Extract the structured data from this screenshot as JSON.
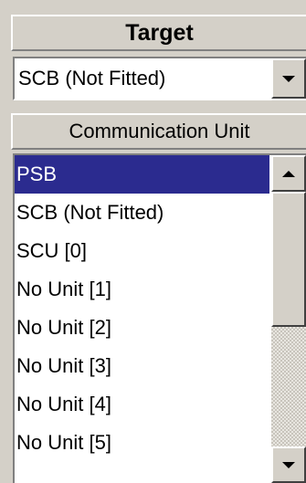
{
  "target_header": "Target",
  "target_select": {
    "value": "SCB (Not Fitted)"
  },
  "comm_header": "Communication Unit",
  "comm_list": {
    "items": [
      "PSB",
      "SCB (Not Fitted)",
      "SCU [0]",
      "No Unit [1]",
      "No Unit [2]",
      "No Unit [3]",
      "No Unit [4]",
      "No Unit [5]"
    ],
    "selected_index": 0
  },
  "colors": {
    "selection": "#2b2b8f",
    "face": "#d4d0c8"
  }
}
